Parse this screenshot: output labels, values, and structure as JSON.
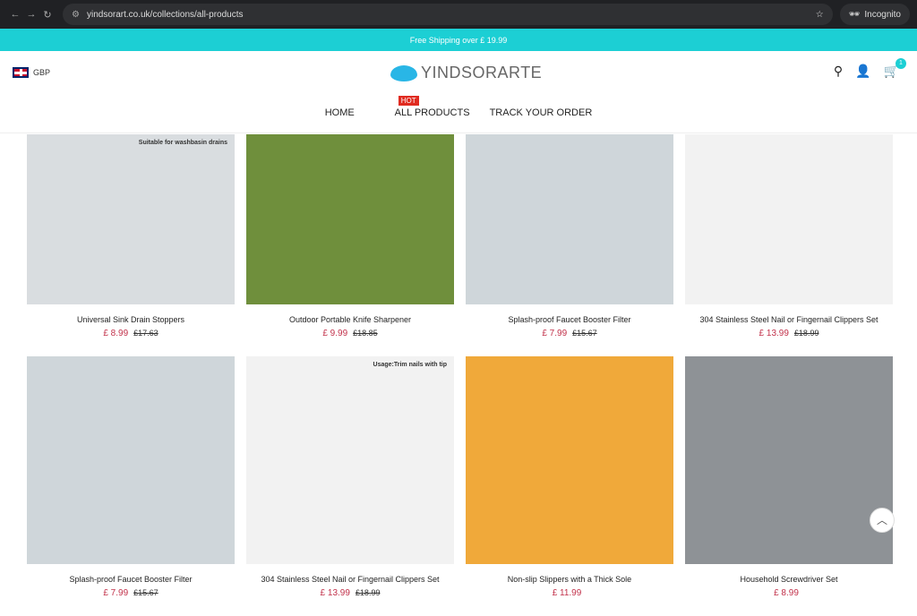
{
  "browser": {
    "url": "yindsorart.co.uk/collections/all-products",
    "incognito_label": "Incognito"
  },
  "banner": {
    "text": "Free Shipping over  £ 19.99"
  },
  "header": {
    "currency": "GBP",
    "logo": "YINDSORARTE",
    "cart_count": "1"
  },
  "menu": {
    "items": [
      "HOME",
      "ALL PRODUCTS",
      "TRACK YOUR ORDER"
    ],
    "hot_badge": "HOT"
  },
  "products": [
    {
      "title": "Universal Sink Drain Stoppers",
      "price": "£ 8.99",
      "old_price": "£17.63",
      "color": "#d9dde0",
      "overlay": "Suitable for washbasin drains"
    },
    {
      "title": "Outdoor Portable Knife Sharpener",
      "price": "£ 9.99",
      "old_price": "£18.85",
      "color": "#6f8f3c",
      "overlay": ""
    },
    {
      "title": "Splash-proof Faucet Booster Filter",
      "price": "£ 7.99",
      "old_price": "£15.67",
      "color": "#cfd6da",
      "overlay": ""
    },
    {
      "title": "304 Stainless Steel Nail or Fingernail Clippers Set",
      "price": "£ 13.99",
      "old_price": "£18.99",
      "color": "#f2f2f2",
      "overlay": ""
    },
    {
      "title": "Splash-proof Faucet Booster Filter",
      "price": "£ 7.99",
      "old_price": "£15.67",
      "color": "#cfd6da",
      "overlay": ""
    },
    {
      "title": "304 Stainless Steel Nail or Fingernail Clippers Set",
      "price": "£ 13.99",
      "old_price": "£18.99",
      "color": "#f2f2f2",
      "overlay": "Usage:Trim nails with tip"
    },
    {
      "title": "Non-slip Slippers with a Thick Sole",
      "price": "£ 11.99",
      "old_price": "",
      "color": "#f0a93a",
      "overlay": ""
    },
    {
      "title": "Household Screwdriver Set",
      "price": "£ 8.99",
      "old_price": "",
      "color": "#8e9296",
      "overlay": ""
    }
  ]
}
